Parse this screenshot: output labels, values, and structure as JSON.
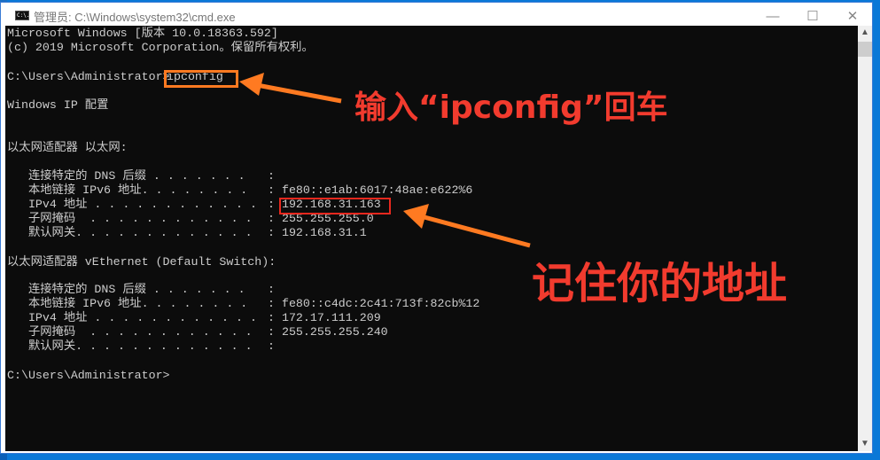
{
  "window": {
    "title": "管理员: C:\\Windows\\system32\\cmd.exe",
    "icon_label": "C:\\.",
    "minimize": "—",
    "maximize": "☐",
    "close": "✕"
  },
  "console": {
    "lines": [
      "Microsoft Windows [版本 10.0.18363.592]",
      "(c) 2019 Microsoft Corporation。保留所有权利。",
      "C:\\Users\\Administrator>",
      "ipconfig",
      "Windows IP 配置",
      "以太网适配器 以太网:",
      "以太网适配器 vEthernet (Default Switch):",
      "C:\\Users\\Administrator>"
    ],
    "adapter1": [
      {
        "label": "   连接特定的 DNS 后缀 . . . . . . .",
        "value": ":"
      },
      {
        "label": "   本地链接 IPv6 地址. . . . . . . .",
        "value": ": fe80::e1ab:6017:48ae:e622%6"
      },
      {
        "label": "   IPv4 地址 . . . . . . . . . . . .",
        "value": ": 192.168.31.163"
      },
      {
        "label": "   子网掩码  . . . . . . . . . . . .",
        "value": ": 255.255.255.0"
      },
      {
        "label": "   默认网关. . . . . . . . . . . . .",
        "value": ": 192.168.31.1"
      }
    ],
    "adapter2": [
      {
        "label": "   连接特定的 DNS 后缀 . . . . . . .",
        "value": ":"
      },
      {
        "label": "   本地链接 IPv6 地址. . . . . . . .",
        "value": ": fe80::c4dc:2c41:713f:82cb%12"
      },
      {
        "label": "   IPv4 地址 . . . . . . . . . . . .",
        "value": ": 172.17.111.209"
      },
      {
        "label": "   子网掩码  . . . . . . . . . . . .",
        "value": ": 255.255.255.240"
      },
      {
        "label": "   默认网关. . . . . . . . . . . . .",
        "value": ":"
      }
    ]
  },
  "annotations": {
    "note1": "输入“ipconfig”回车",
    "note2": "记住你的地址",
    "arrow_color": "#ff7a21",
    "text_color": "#f23b2e"
  },
  "scrollbar": {
    "up": "▲",
    "down": "▼"
  }
}
